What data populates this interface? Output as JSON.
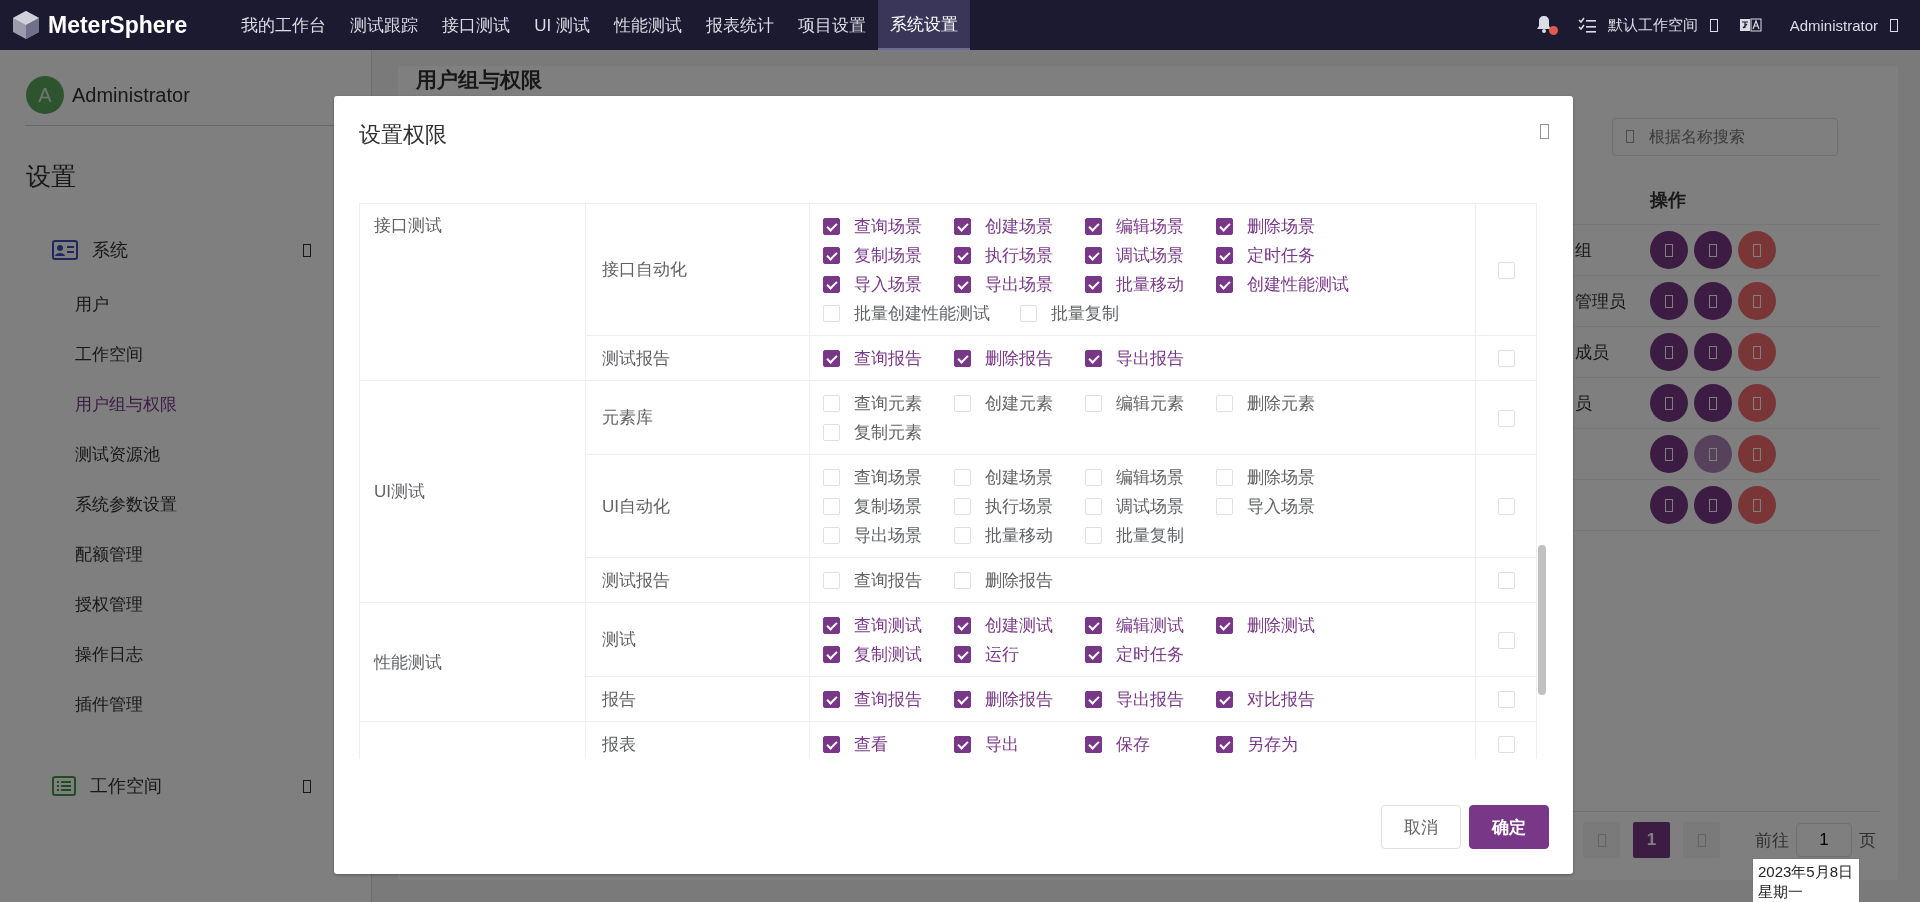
{
  "top_nav": {
    "logo": "MeterSphere",
    "items": [
      {
        "label": "我的工作台",
        "selected": false
      },
      {
        "label": "测试跟踪",
        "selected": false
      },
      {
        "label": "接口测试",
        "selected": false
      },
      {
        "label": "UI 测试",
        "selected": false
      },
      {
        "label": "性能测试",
        "selected": false
      },
      {
        "label": "报表统计",
        "selected": false
      },
      {
        "label": "项目设置",
        "selected": false
      },
      {
        "label": "系统设置",
        "selected": true
      }
    ],
    "workspace": "默认工作空间",
    "user": "Administrator"
  },
  "sidebar": {
    "user": {
      "initial": "A",
      "name": "Administrator"
    },
    "title": "设置",
    "groups": [
      {
        "label": "系统",
        "items": [
          {
            "label": "用户",
            "selected": false
          },
          {
            "label": "工作空间",
            "selected": false
          },
          {
            "label": "用户组与权限",
            "selected": true
          },
          {
            "label": "测试资源池",
            "selected": false
          },
          {
            "label": "系统参数设置",
            "selected": false
          },
          {
            "label": "配额管理",
            "selected": false
          },
          {
            "label": "授权管理",
            "selected": false
          },
          {
            "label": "操作日志",
            "selected": false
          },
          {
            "label": "插件管理",
            "selected": false
          }
        ]
      },
      {
        "label": "工作空间"
      }
    ]
  },
  "main": {
    "title": "用户组与权限",
    "search": {
      "placeholder": "根据名称搜索"
    },
    "table": {
      "columns": [
        "操作"
      ],
      "rows": [
        {
          "name": "组",
          "actions": [
            {
              "kind": "primary",
              "disabled": false
            },
            {
              "kind": "primary",
              "disabled": false
            },
            {
              "kind": "danger",
              "disabled": false
            }
          ]
        },
        {
          "name": "管理员",
          "actions": [
            {
              "kind": "primary",
              "disabled": false
            },
            {
              "kind": "primary",
              "disabled": false
            },
            {
              "kind": "danger",
              "disabled": false
            }
          ]
        },
        {
          "name": "成员",
          "actions": [
            {
              "kind": "primary",
              "disabled": false
            },
            {
              "kind": "primary",
              "disabled": false
            },
            {
              "kind": "danger",
              "disabled": false
            }
          ]
        },
        {
          "name": "员",
          "actions": [
            {
              "kind": "primary",
              "disabled": false
            },
            {
              "kind": "primary",
              "disabled": false
            },
            {
              "kind": "danger",
              "disabled": false
            }
          ]
        },
        {
          "actions": [
            {
              "kind": "primary",
              "disabled": false
            },
            {
              "kind": "primary",
              "disabled": true
            },
            {
              "kind": "danger",
              "disabled": false
            }
          ]
        },
        {
          "actions": [
            {
              "kind": "primary",
              "disabled": false
            },
            {
              "kind": "primary",
              "disabled": false
            },
            {
              "kind": "danger",
              "disabled": false
            }
          ]
        }
      ]
    },
    "pagination": {
      "pages": [
        {
          "label": "1",
          "selected": true
        }
      ],
      "goto_label": "前往",
      "goto_value": "1",
      "page_suffix": "页"
    }
  },
  "dialog": {
    "title": "设置权限",
    "groups": [
      {
        "name": "接口测试",
        "resources": [
          {
            "name": "接口自动化",
            "all_checked": false,
            "permissions": [
              {
                "label": "查询场景",
                "checked": true
              },
              {
                "label": "创建场景",
                "checked": true
              },
              {
                "label": "编辑场景",
                "checked": true
              },
              {
                "label": "删除场景",
                "checked": true
              },
              {
                "label": "复制场景",
                "checked": true
              },
              {
                "label": "执行场景",
                "checked": true
              },
              {
                "label": "调试场景",
                "checked": true
              },
              {
                "label": "定时任务",
                "checked": true
              },
              {
                "label": "导入场景",
                "checked": true
              },
              {
                "label": "导出场景",
                "checked": true
              },
              {
                "label": "批量移动",
                "checked": true
              },
              {
                "label": "创建性能测试",
                "checked": true
              },
              {
                "label": "批量创建性能测试",
                "checked": false
              },
              {
                "label": "批量复制",
                "checked": false
              }
            ]
          },
          {
            "name": "测试报告",
            "all_checked": false,
            "permissions": [
              {
                "label": "查询报告",
                "checked": true
              },
              {
                "label": "删除报告",
                "checked": true
              },
              {
                "label": "导出报告",
                "checked": true
              }
            ]
          }
        ]
      },
      {
        "name": "UI测试",
        "resources": [
          {
            "name": "元素库",
            "all_checked": false,
            "permissions": [
              {
                "label": "查询元素",
                "checked": false
              },
              {
                "label": "创建元素",
                "checked": false
              },
              {
                "label": "编辑元素",
                "checked": false
              },
              {
                "label": "删除元素",
                "checked": false
              },
              {
                "label": "复制元素",
                "checked": false
              }
            ]
          },
          {
            "name": "UI自动化",
            "all_checked": false,
            "permissions": [
              {
                "label": "查询场景",
                "checked": false
              },
              {
                "label": "创建场景",
                "checked": false
              },
              {
                "label": "编辑场景",
                "checked": false
              },
              {
                "label": "删除场景",
                "checked": false
              },
              {
                "label": "复制场景",
                "checked": false
              },
              {
                "label": "执行场景",
                "checked": false
              },
              {
                "label": "调试场景",
                "checked": false
              },
              {
                "label": "导入场景",
                "checked": false
              },
              {
                "label": "导出场景",
                "checked": false
              },
              {
                "label": "批量移动",
                "checked": false
              },
              {
                "label": "批量复制",
                "checked": false
              }
            ]
          },
          {
            "name": "测试报告",
            "all_checked": false,
            "permissions": [
              {
                "label": "查询报告",
                "checked": false
              },
              {
                "label": "删除报告",
                "checked": false
              }
            ]
          }
        ]
      },
      {
        "name": "性能测试",
        "resources": [
          {
            "name": "测试",
            "all_checked": false,
            "permissions": [
              {
                "label": "查询测试",
                "checked": true
              },
              {
                "label": "创建测试",
                "checked": true
              },
              {
                "label": "编辑测试",
                "checked": true
              },
              {
                "label": "删除测试",
                "checked": true
              },
              {
                "label": "复制测试",
                "checked": true
              },
              {
                "label": "运行",
                "checked": true
              },
              {
                "label": "定时任务",
                "checked": true
              }
            ]
          },
          {
            "name": "报告",
            "all_checked": false,
            "permissions": [
              {
                "label": "查询报告",
                "checked": true
              },
              {
                "label": "删除报告",
                "checked": true
              },
              {
                "label": "导出报告",
                "checked": true
              },
              {
                "label": "对比报告",
                "checked": true
              }
            ]
          }
        ]
      },
      {
        "resources": [
          {
            "name": "报表",
            "all_checked": false,
            "permissions": [
              {
                "label": "查看",
                "checked": true
              },
              {
                "label": "导出",
                "checked": true
              },
              {
                "label": "保存",
                "checked": true
              },
              {
                "label": "另存为",
                "checked": true
              }
            ]
          }
        ]
      }
    ],
    "buttons": [
      {
        "label": "取消",
        "kind": "secondary"
      },
      {
        "label": "确定",
        "kind": "primary"
      }
    ]
  },
  "tooltip": {
    "lines": [
      "2023年5月8日",
      "星期一"
    ]
  }
}
